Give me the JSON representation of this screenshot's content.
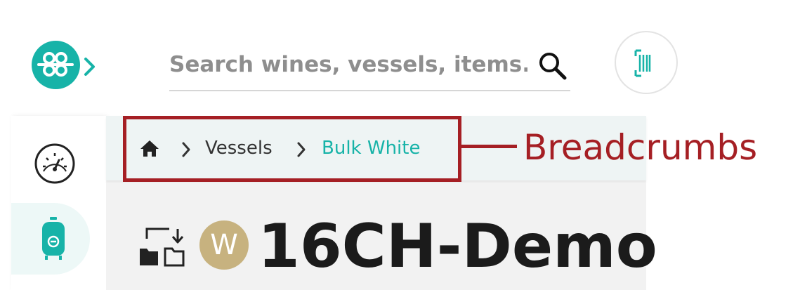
{
  "header": {
    "logo_icon": "bubbles-logo-icon",
    "expand_icon": "chevron-right-icon",
    "search": {
      "placeholder": "Search wines, vessels, items...",
      "value": ""
    },
    "search_icon": "search-icon",
    "scan_icon": "barcode-scan-icon"
  },
  "sidebar": {
    "items": [
      {
        "icon": "dashboard-gauge-icon",
        "active": false
      },
      {
        "icon": "vessel-tank-icon",
        "active": true
      }
    ]
  },
  "breadcrumb": {
    "home_icon": "home-icon",
    "items": [
      "Vessels",
      "Bulk White"
    ]
  },
  "annotation": {
    "label": "Breadcrumbs"
  },
  "vessel": {
    "move_icon": "move-vessel-icon",
    "badge": "W",
    "title": "16CH-Demo"
  },
  "colors": {
    "accent": "#17b3a8",
    "annotation": "#a51f24",
    "badge": "#c7b27f",
    "sidebar_active": "#edf8f7"
  }
}
